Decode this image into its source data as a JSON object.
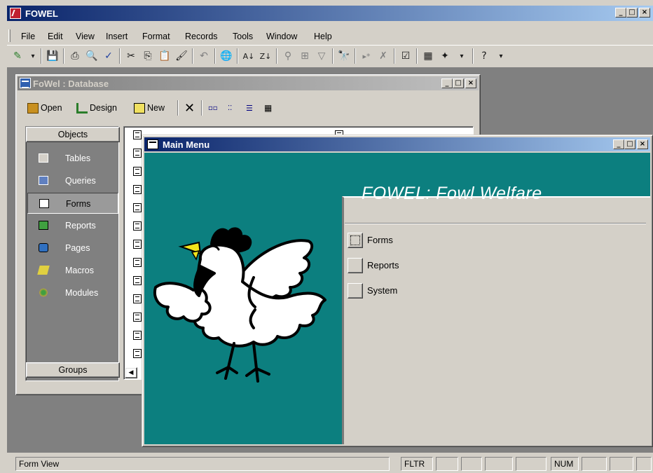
{
  "app": {
    "title": "FOWEL"
  },
  "menu": [
    "File",
    "Edit",
    "View",
    "Insert",
    "Format",
    "Records",
    "Tools",
    "Window",
    "Help"
  ],
  "toolbar": {
    "icons": [
      "view-icon",
      "save-icon",
      "print-icon",
      "print-preview-icon",
      "spelling-icon",
      "cut-icon",
      "copy-icon",
      "paste-icon",
      "format-painter-icon",
      "undo-icon",
      "hyperlink-icon",
      "sort-ascending-icon",
      "sort-descending-icon",
      "filter-by-selection-icon",
      "filter-by-form-icon",
      "apply-filter-icon",
      "find-icon",
      "new-record-icon",
      "delete-record-icon",
      "properties-icon",
      "database-window-icon",
      "new-object-icon",
      "help-icon"
    ]
  },
  "database_window": {
    "title": "FoWel : Database",
    "toolbar": {
      "open": "Open",
      "design": "Design",
      "new": "New"
    },
    "objects_header": "Objects",
    "objects": [
      "Tables",
      "Queries",
      "Forms",
      "Reports",
      "Pages",
      "Macros",
      "Modules"
    ],
    "selected_object": "Forms",
    "groups_header": "Groups"
  },
  "main_menu": {
    "title": "Main Menu",
    "heading": "FOWEL: Fowl Welfare",
    "buttons": [
      "Forms",
      "Reports",
      "System"
    ],
    "colors": {
      "background": "#0c7f7f",
      "heading": "#ffffff"
    }
  },
  "status": {
    "mode": "Form View",
    "fltr": "FLTR",
    "num": "NUM"
  },
  "colors": {
    "title_active": "#0a246a",
    "title_inactive": "#808080",
    "face": "#d4d0c8"
  }
}
